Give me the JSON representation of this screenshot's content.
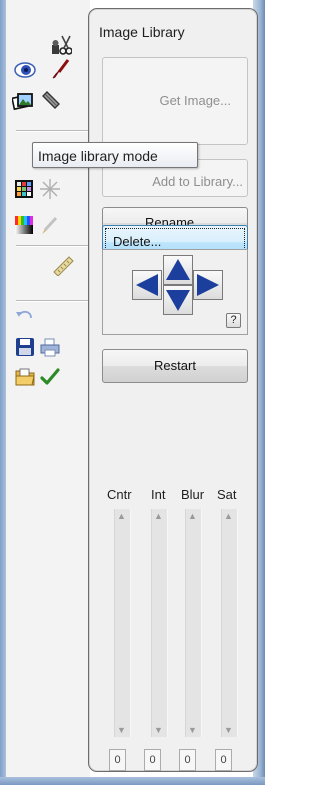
{
  "tooltip": {
    "text": "Image library mode"
  },
  "panel": {
    "title": "Image Library",
    "buttons": {
      "get_image": "Get Image...",
      "add_to_library": "Add to Library...",
      "rename": "Rename...",
      "delete": "Delete...",
      "restart": "Restart"
    },
    "help_label": "?",
    "sliders": [
      {
        "label": "Cntr",
        "value": "0"
      },
      {
        "label": "Int",
        "value": "0"
      },
      {
        "label": "Blur",
        "value": "0"
      },
      {
        "label": "Sat",
        "value": "0"
      }
    ]
  },
  "toolbox": {
    "icons": [
      "eyedropper-scissors-icon",
      "eye-icon",
      "brush-icon",
      "image-stack-icon",
      "ruler-pencil-icon",
      "color-palette-icon",
      "wand-icon",
      "color-bars-icon",
      "dropper-icon",
      "ruler-icon",
      "undo-icon",
      "save-icon",
      "print-icon",
      "open-folder-icon",
      "checkmark-icon"
    ]
  },
  "colors": {
    "arrow_blue": "#1c3e9c",
    "check_green": "#2d8a24",
    "panel_bg": "#f0f0f0"
  }
}
